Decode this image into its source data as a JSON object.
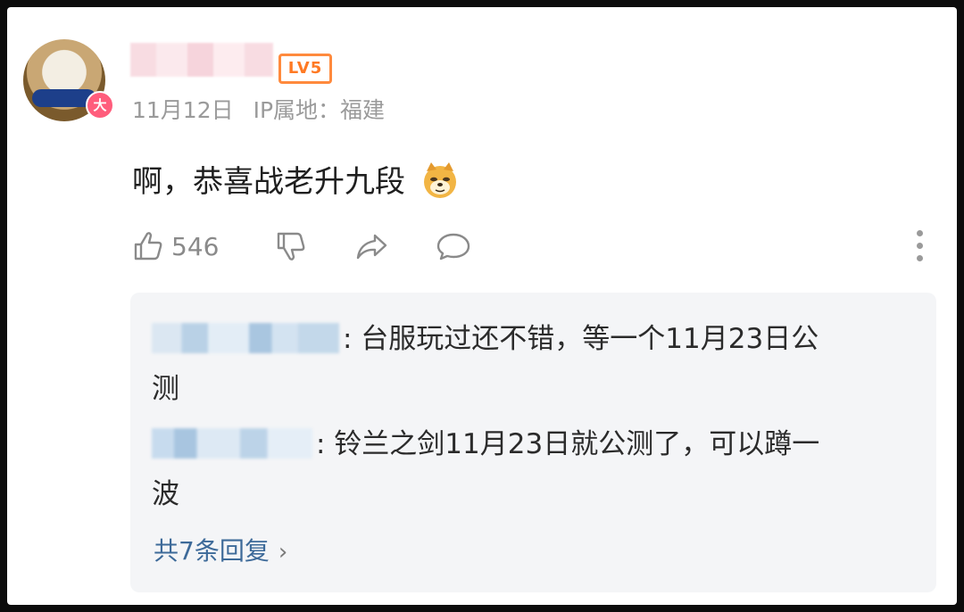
{
  "comment": {
    "level_badge": "LV5",
    "avatar_badge": "大",
    "date": "11月12日",
    "ip_location": "IP属地：福建",
    "text": "啊，恭喜战老升九段",
    "emoji": "doge-emoji",
    "like_count": "546"
  },
  "icons": {
    "like": "thumbs-up-icon",
    "dislike": "thumbs-down-icon",
    "share": "share-icon",
    "reply": "comment-bubble-icon",
    "more": "more-vertical-icon"
  },
  "replies": [
    {
      "text": ": 台服玩过还不错，等一个11月23日公",
      "text2": "测"
    },
    {
      "text": ": 铃兰之剑11月23日就公测了，可以蹲一",
      "text2": "波"
    }
  ],
  "replies_link": "共7条回复",
  "colors": {
    "level": "#ff7a24",
    "link": "#3d6a99",
    "reply_bg": "#f4f5f7"
  }
}
